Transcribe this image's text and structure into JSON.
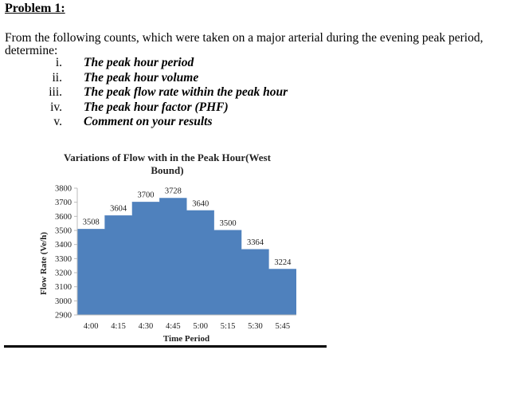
{
  "document": {
    "heading": "Problem 1:",
    "paragraph": "From the following counts, which were taken on a major arterial during the evening peak period, determine:",
    "items": [
      {
        "num": "i.",
        "text": "The peak hour period"
      },
      {
        "num": "ii.",
        "text": "The peak hour volume"
      },
      {
        "num": "iii.",
        "text": "The peak flow rate within the peak hour"
      },
      {
        "num": "iv.",
        "text": "The peak hour factor (PHF)"
      },
      {
        "num": "v.",
        "text": "Comment on your results"
      }
    ]
  },
  "chart_data": {
    "type": "area",
    "title": "Variations of Flow with in the Peak Hour(West Bound)",
    "title_lines": [
      "Variations of Flow with in the Peak Hour(West",
      "Bound)"
    ],
    "xlabel": "Time Period",
    "ylabel": "Flow Rate (Ve/h)",
    "categories": [
      "4:00",
      "4:15",
      "4:30",
      "4:45",
      "5:00",
      "5:15",
      "5:30",
      "5:45"
    ],
    "values": [
      3508,
      3604,
      3700,
      3728,
      3640,
      3500,
      3364,
      3224
    ],
    "ylim": [
      2900,
      3800
    ],
    "yticks": [
      2900,
      3000,
      3100,
      3200,
      3300,
      3400,
      3500,
      3600,
      3700,
      3800
    ],
    "grid": false,
    "color": "#4F81BD"
  }
}
